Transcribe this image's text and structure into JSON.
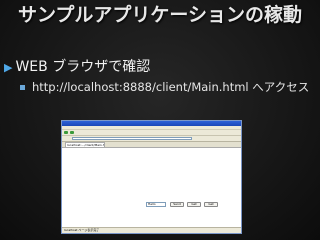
{
  "slide": {
    "title": "サンプルアプリケーションの稼動",
    "bullet": "WEB ブラウザで確認",
    "sub_bullet": "http://localhost:8888/client/Main.html へアクセス"
  },
  "browser": {
    "tab_label": "localhost:.../client/Main.html",
    "input_value": "Hello",
    "buttons": [
      "Send",
      "Get",
      "Get"
    ],
    "status_text": "localhost ページ表示完了"
  }
}
